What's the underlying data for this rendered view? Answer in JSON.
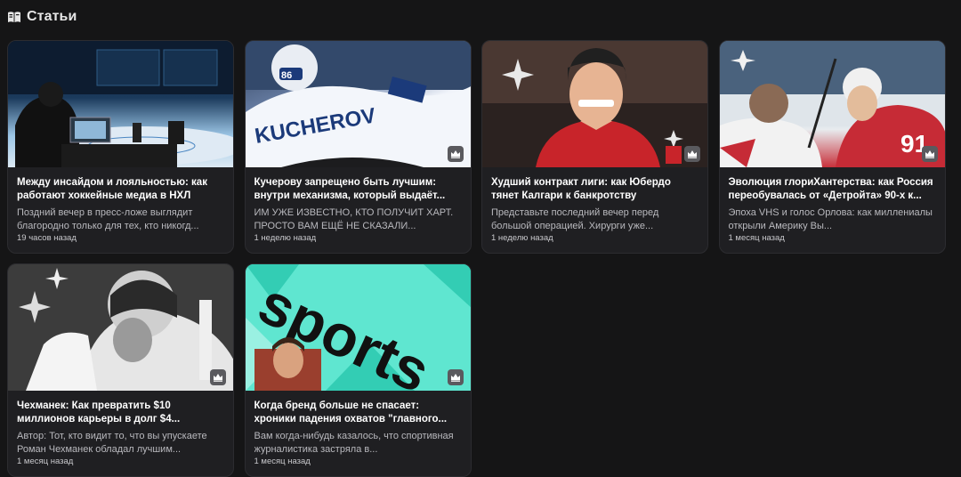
{
  "section": {
    "title": "Статьи",
    "icon": "book-icon"
  },
  "articles": [
    {
      "title": "Между инсайдом и лояльностью: как работают хоккейные медиа в НХЛ",
      "excerpt": "Поздний вечер в пресс-ложе выглядит благородно только для тех, кто никогд...",
      "time": "19 часов назад",
      "premium": false,
      "image": "hockey-arena-press-box"
    },
    {
      "title": "Кучерову запрещено быть лучшим: внутри механизма, который выдаёт...",
      "excerpt": "ИМ УЖЕ ИЗВЕСТНО, КТО ПОЛУЧИТ ХАРТ. ПРОСТО ВАМ ЕЩЁ НЕ СКАЗАЛИ...",
      "time": "1 неделю назад",
      "premium": true,
      "image": "kucherov-jersey-86"
    },
    {
      "title": "Худший контракт лиги: как Юбердо тянет Калгари к банкротству",
      "excerpt": "Представьте последний вечер перед большой операцией. Хирурги уже...",
      "time": "1 неделю назад",
      "premium": true,
      "image": "huberdeau-portrait"
    },
    {
      "title": "Эволюция глориХантерства: как Россия переобувалась от «Детройта» 90-х к...",
      "excerpt": "Эпоха VHS и голос Орлова: как миллениалы открыли Америку Вы...",
      "time": "1 месяц назад",
      "premium": true,
      "image": "ovechkin-kucherov-capitals"
    },
    {
      "title": "Чехманек: Как превратить $10 миллионов карьеры в долг $4...",
      "excerpt": "Автор: Тот, кто видит то, что вы упускаете Роман Чехманек обладал лучшим...",
      "time": "1 месяц назад",
      "premium": true,
      "image": "goalie-bw"
    },
    {
      "title": "Когда бренд больше не спасает: хроники падения охватов \"главного...",
      "excerpt": "Вам когда-нибудь казалось, что спортивная журналистика застряла в...",
      "time": "1 месяц назад",
      "premium": true,
      "image": "sportsru-logo-collage",
      "image_text": "sports"
    }
  ]
}
